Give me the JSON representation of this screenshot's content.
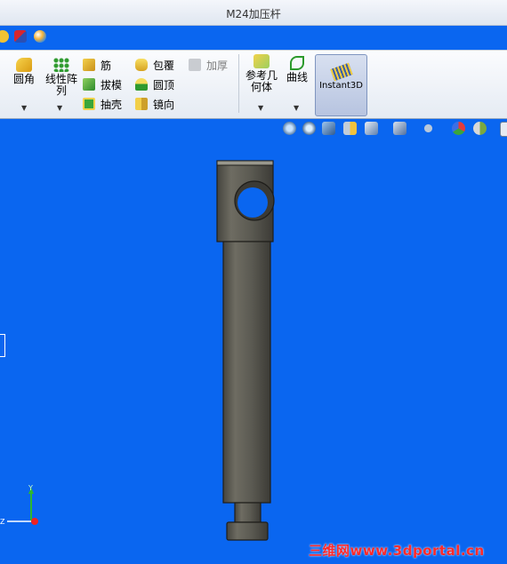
{
  "window": {
    "title": "M24加压杆"
  },
  "ribbon": {
    "fillet": "圆角",
    "linear_pattern_line1": "线性阵",
    "linear_pattern_line2": "列",
    "rib": "筋",
    "draft": "拔模",
    "shell": "抽壳",
    "wrap": "包覆",
    "dome": "圆顶",
    "mirror": "镜向",
    "thicken": "加厚",
    "reference_geometry_line1": "参考几",
    "reference_geometry_line2": "何体",
    "curves": "曲线",
    "instant3d": "Instant3D"
  },
  "watermark": "三维网www.3dportal.cn",
  "colors": {
    "viewport": "#0a66f0",
    "part": "#5b5a52"
  },
  "icons": [
    "fillet-icon",
    "linear-pattern-icon",
    "rib-icon",
    "draft-icon",
    "shell-icon",
    "wrap-icon",
    "dome-icon",
    "mirror-icon",
    "thicken-icon",
    "reference-geometry-icon",
    "curves-icon",
    "instant3d-icon",
    "zoom-to-fit-icon",
    "zoom-area-icon",
    "previous-view-icon",
    "section-view-icon",
    "view-orientation-icon",
    "display-style-icon",
    "hide-show-icon",
    "edit-appearance-icon",
    "apply-scene-icon"
  ]
}
